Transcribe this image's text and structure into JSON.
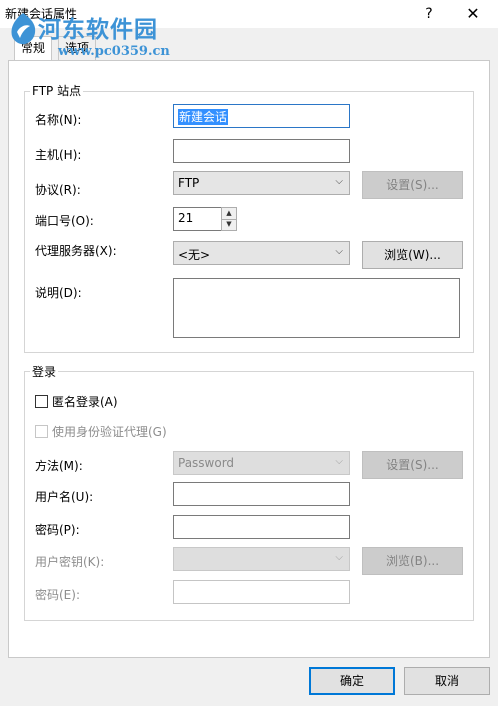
{
  "window": {
    "title": "新建会话属性",
    "help": "?",
    "close": "✕"
  },
  "watermark": {
    "text": "河东软件园",
    "url": "www.pc0359.cn"
  },
  "tabs": [
    "常规",
    "选项"
  ],
  "ftp_site": {
    "group_label": "FTP 站点",
    "name_label": "名称(N):",
    "name_value": "新建会话",
    "host_label": "主机(H):",
    "host_value": "",
    "protocol_label": "协议(R):",
    "protocol_value": "FTP",
    "settings_button": "设置(S)...",
    "port_label": "端口号(O):",
    "port_value": "21",
    "proxy_label": "代理服务器(X):",
    "proxy_value": "<无>",
    "browse_button": "浏览(W)...",
    "description_label": "说明(D):",
    "description_value": ""
  },
  "login": {
    "group_label": "登录",
    "anonymous_label": "匿名登录(A)",
    "auth_proxy_label": "使用身份验证代理(G)",
    "method_label": "方法(M):",
    "method_value": "Password",
    "settings_button": "设置(S)...",
    "username_label": "用户名(U):",
    "username_value": "",
    "password_label": "密码(P):",
    "password_value": "",
    "userkey_label": "用户密钥(K):",
    "userkey_value": "",
    "browse_button": "浏览(B)...",
    "passphrase_label": "密码(E):",
    "passphrase_value": ""
  },
  "footer": {
    "ok": "确定",
    "cancel": "取消"
  },
  "colors": {
    "accent": "#0078d7",
    "watermark": "#3d93d6",
    "selection": "#3390ff"
  }
}
